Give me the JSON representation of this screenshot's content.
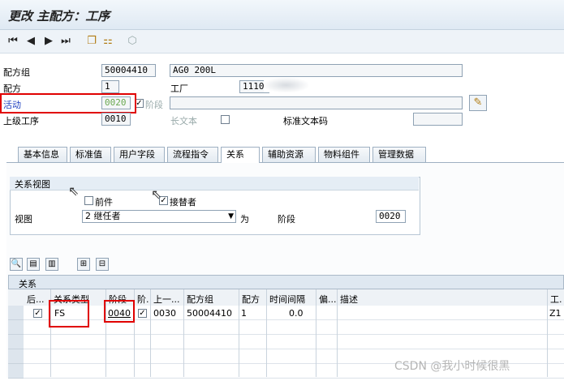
{
  "window": {
    "title": "更改 主配方：工序"
  },
  "toolbar": {
    "icons": [
      "first-record-icon",
      "previous-record-icon",
      "next-record-icon",
      "last-record-icon",
      "copy-icon",
      "hierarchy-icon",
      "check-icon"
    ]
  },
  "header": {
    "recipe_group_label": "配方组",
    "recipe_group_value": "50004410",
    "recipe_group_desc": "AG0 200L",
    "recipe_label": "配方",
    "recipe_value": "1",
    "plant_label": "工厂",
    "plant_value": "1110",
    "activity_label": "活动",
    "activity_value": "0020",
    "phase_label": "阶段",
    "parent_op_label": "上级工序",
    "parent_op_value": "0010",
    "long_text_label": "长文本",
    "std_text_label": "标准文本码"
  },
  "tabs": [
    "基本信息",
    "标准值",
    "用户字段",
    "流程指令",
    "关系",
    "辅助资源",
    "物料组件",
    "管理数据"
  ],
  "active_tab_index": 4,
  "relation_view": {
    "title": "关系视图",
    "predecessor_label": "前件",
    "successor_label": "接替者",
    "successor_checked": true,
    "view_label": "视图",
    "view_value": "2 继任者",
    "for_label": "为",
    "phase_label": "阶段",
    "phase_value": "0020"
  },
  "relations_table": {
    "title": "关系",
    "columns": [
      "后...",
      "关系类型",
      "阶段",
      "阶.",
      "上一...",
      "配方组",
      "配方",
      "时间间隔",
      "偏...",
      "描述",
      "工."
    ],
    "rows": [
      {
        "checked": true,
        "relation_type": "FS",
        "phase": "0040",
        "phase_checked": true,
        "prev": "0030",
        "recipe_group": "50004410",
        "recipe": "1",
        "interval": "0.0",
        "offset": "",
        "description": "",
        "work": "Z1"
      }
    ]
  },
  "watermark": "CSDN @我小时候很黑"
}
